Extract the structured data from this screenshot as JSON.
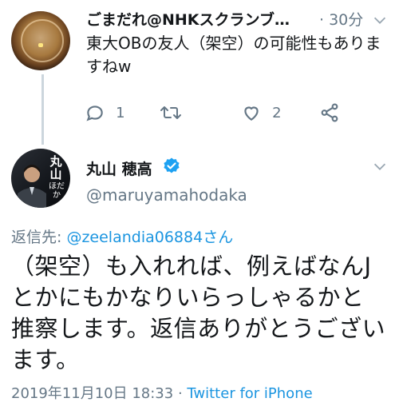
{
  "reply_tweet": {
    "author_name": "ごまだれ@NHKスクランブ…",
    "separator": "·",
    "time": "30分",
    "text": "東大OBの友人（架空）の可能性もありますねw",
    "actions": {
      "reply": {
        "icon": "reply-icon",
        "count": "1"
      },
      "retweet": {
        "icon": "retweet-icon",
        "count": ""
      },
      "like": {
        "icon": "heart-icon",
        "count": "2"
      },
      "share": {
        "icon": "share-icon"
      }
    }
  },
  "main_tweet": {
    "author_name": "丸山 穂高",
    "verified": true,
    "handle": "@maruyamahodaka",
    "avatar_text": "丸山",
    "avatar_sub": "ほだか",
    "reply_label": "返信先: ",
    "reply_to": "@zeelandia06884さん",
    "text": "（架空）も入れれば、例えばなんJとかにもかなりいらっしゃるかと推察します。返信ありがとうございます。",
    "timestamp": "2019年11月10日 18:33",
    "meta_separator": " · ",
    "client": "Twitter for iPhone"
  },
  "colors": {
    "accent": "#1b95e0",
    "secondary_text": "#657786",
    "thread_line": "#ccd6dd"
  }
}
